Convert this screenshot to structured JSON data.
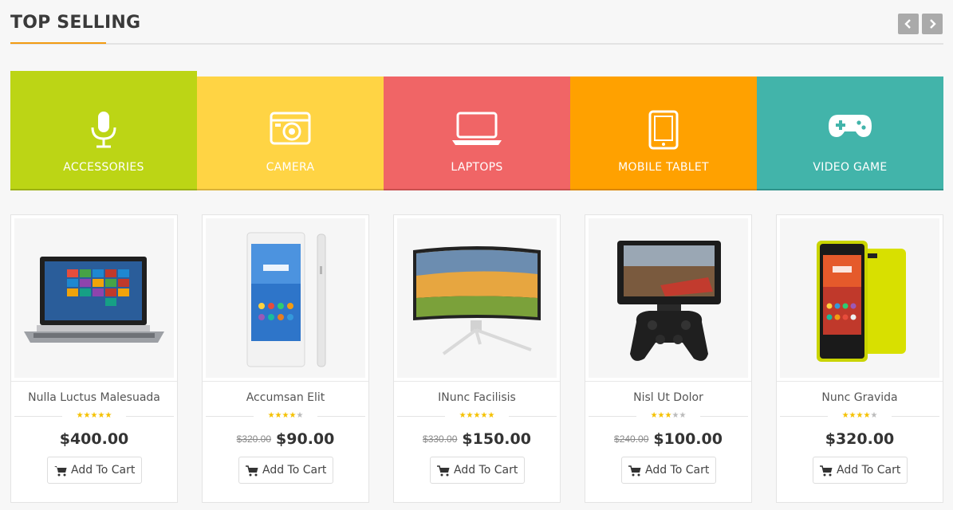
{
  "section": {
    "title": "TOP SELLING"
  },
  "nav": {
    "prev_icon": "chevron-left-icon",
    "next_icon": "chevron-right-icon"
  },
  "categories": [
    {
      "label": "ACCESSORIES",
      "icon": "microphone-icon",
      "color": "#bcd515"
    },
    {
      "label": "CAMERA",
      "icon": "camera-icon",
      "color": "#ffd444"
    },
    {
      "label": "LAPTOPS",
      "icon": "laptop-icon",
      "color": "#f06566"
    },
    {
      "label": "MOBILE TABLET",
      "icon": "tablet-icon",
      "color": "#ffa100"
    },
    {
      "label": "VIDEO GAME",
      "icon": "gamepad-icon",
      "color": "#42b4aa"
    }
  ],
  "products": [
    {
      "name": "Nulla Luctus Malesuada",
      "rating": 5,
      "old_price": "",
      "price": "$400.00",
      "button": "Add To Cart",
      "image": "laptop-image"
    },
    {
      "name": "Accumsan Elit",
      "rating": 4,
      "old_price": "$320.00",
      "price": "$90.00",
      "button": "Add To Cart",
      "image": "smartphone-image"
    },
    {
      "name": "INunc Facilisis",
      "rating": 5,
      "old_price": "$330.00",
      "price": "$150.00",
      "button": "Add To Cart",
      "image": "monitor-image"
    },
    {
      "name": "Nisl Ut Dolor",
      "rating": 3,
      "old_price": "$240.00",
      "price": "$100.00",
      "button": "Add To Cart",
      "image": "phone-controller-image"
    },
    {
      "name": "Nunc Gravida",
      "rating": 4,
      "old_price": "",
      "price": "$320.00",
      "button": "Add To Cart",
      "image": "yellow-phone-image"
    }
  ]
}
